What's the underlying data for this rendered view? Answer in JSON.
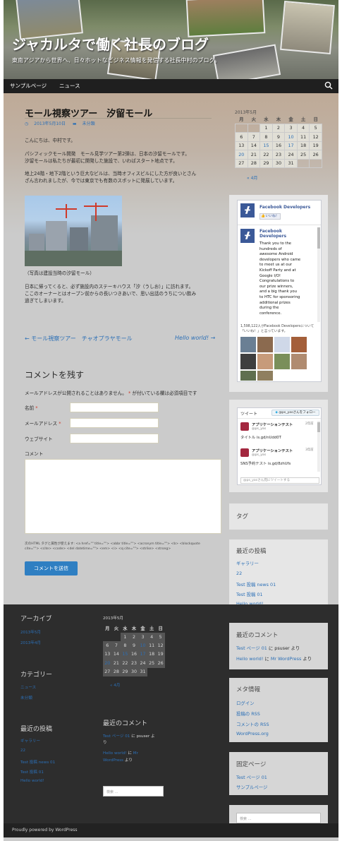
{
  "header": {
    "title": "ジャカルタで働く社長のブログ",
    "tagline": "東南アジアから世界へ、日々ホットなビジネス情報を発信する社長中村のブログ。"
  },
  "nav": {
    "items": [
      "サンプルページ",
      "ニュース"
    ],
    "search_icon": "search-icon"
  },
  "post": {
    "title": "モール視察ツアー　汐留モール",
    "date": "2013年5月10日",
    "category": "未分類",
    "greeting": "こんにちは、中村です。",
    "para1_l1": "パシフィックモール開発　モール見学ツアー第2弾は、日本の汐留モールです。",
    "para1_l2": "汐留モールは私たちが最初に開発した施設で、いわばスタート地点です。",
    "para2_l1": "地上24階・地下2階という巨大なビルは、当時オフィスビルにした方が良いとさん",
    "para2_l2": "ざん言われましたが、今では東京でも有数のスポットに発展しています。",
    "caption": "（写真は建設当時の汐留モール）",
    "para3_l1": "日本に帰ってくると、必ず施設内のステーキハウス「汐（うしお）」に訪れます。",
    "para3_l2": "ここのオーナーとはオープン前からの長いつきあいで、思い出話のうちについ飲み",
    "para3_l3": "過ぎてしまいます。",
    "prev_link": "← モール視察ツアー　チャオプラヤモール",
    "next_link": "Hello world! →"
  },
  "comment_form": {
    "heading": "コメントを残す",
    "note": "メールアドレスが公開されることはありません。",
    "note_req_mark": "*",
    "note_tail": "が付いている欄は必須項目です",
    "name_label": "名前",
    "email_label": "メールアドレス",
    "website_label": "ウェブサイト",
    "comment_label": "コメント",
    "req_mark": "*",
    "tags_note_l1": "次のHTML タグと属性が使えます: <a href=\"\" title=\"\"> <abbr title=\"\"> <acronym title=\"\"> <b> <blockquote",
    "tags_note_l2": "cite=\"\"> <cite> <code> <del datetime=\"\"> <em> <i> <q cite=\"\"> <strike> <strong>",
    "submit": "コメントを送信"
  },
  "sidebar": {
    "calendar": {
      "title": "2013年5月",
      "headers": [
        "月",
        "火",
        "水",
        "木",
        "金",
        "土",
        "日"
      ],
      "rows": [
        [
          "",
          "",
          "1",
          "2",
          "3",
          "4",
          "5"
        ],
        [
          "6",
          "7",
          "8",
          "9",
          "10",
          "11",
          "12"
        ],
        [
          "13",
          "14",
          "15",
          "16",
          "17",
          "18",
          "19"
        ],
        [
          "20",
          "21",
          "22",
          "23",
          "24",
          "25",
          "26"
        ],
        [
          "27",
          "28",
          "29",
          "30",
          "31",
          "",
          ""
        ]
      ],
      "linked_days": [
        "10",
        "15",
        "17",
        "20"
      ],
      "prev": "« 4月"
    },
    "facebook": {
      "page_name": "Facebook Developers",
      "like": "いいね！",
      "post_author": "Facebook Developers",
      "post_l1": "Thank you to the",
      "post_l2": "hundreds of",
      "post_l3": "awesome Android",
      "post_l4": "developers who came",
      "post_l5": "to meet us at our",
      "post_l6": "Kickoff Party and at",
      "post_l7": "Google I/O!",
      "post_l8": "Congratulations to",
      "post_l9": "our prize winners,",
      "post_l10": "and a big thank you",
      "post_l11": "to HTC for sponsoring",
      "post_l12": "additional prizes",
      "post_l13": "during the",
      "post_l14": "conference.",
      "count_text": "1,598,122人がFacebook Developersについて「いいね！」と言っています。"
    },
    "twitter": {
      "heading": "ツイート",
      "follow": "@ps_yasさんをフォロー",
      "t1_name": "アプリケーションテスト",
      "t1_handle": "@ps_yas",
      "t1_time": "2年前",
      "t1_text": "タイトル is.gd/nUdd0T",
      "t2_name": "アプリケーションテスト",
      "t2_handle": "@ps_yas",
      "t2_time": "3年前",
      "t2_text": "SNS予約テスト is.gd/8zhUfs",
      "box": "@ps_yasさん宛にツイートする"
    },
    "tags_title": "タグ",
    "recent_posts_title": "最近の投稿",
    "recent_posts": [
      "ギャラリー",
      "22",
      "Test 投稿 news 01",
      "Test 投稿 01",
      "Hello world!"
    ],
    "recent_comments_title": "最近のコメント",
    "rc1_link": "Test ページ 01",
    "rc1_mid": " に ",
    "rc1_user": "psuser",
    "rc1_tail": " より",
    "rc2_link": "Hello world!",
    "rc2_mid": " に ",
    "rc2_user": "Mr WordPress",
    "rc2_tail": " より",
    "meta_title": "メタ情報",
    "meta": [
      "ログイン",
      "投稿の RSS",
      "コメントの RSS",
      "WordPress.org"
    ],
    "fixed_pages_title": "固定ページ",
    "fixed_pages": [
      "Test ページ 01",
      "サンプルページ"
    ],
    "search_placeholder": "検索 …"
  },
  "footer": {
    "archive_title": "アーカイブ",
    "archives": [
      "2013年5月",
      "2013年4月"
    ],
    "category_title": "カテゴリー",
    "categories": [
      "ニュース",
      "未分類"
    ],
    "recent_posts_title": "最近の投稿",
    "recent_posts": [
      "ギャラリー",
      "22",
      "Test 投稿 news 01",
      "Test 投稿 01",
      "Hello world!"
    ],
    "calendar_title": "2013年5月",
    "calendar_prev": "« 4月",
    "recent_comments_title": "最近のコメント",
    "rc1_link": "Test ページ 01",
    "rc1_tail": " に psuser よ",
    "rc1_tail2": "り",
    "rc2_link": "Hello world!",
    "rc2_mid": " に ",
    "rc2_user": "Mr",
    "rc2_user2": "WordPress",
    "rc2_tail": " より",
    "search_placeholder": "検索 …",
    "powered": "Proudly powered by WordPress"
  },
  "colors": {
    "link": "#2b6fb6",
    "nav_bg": "#1f1f1f",
    "footer_bg": "#2d2d2d",
    "button": "#2f7fc2",
    "required": "#cf3a2a"
  }
}
